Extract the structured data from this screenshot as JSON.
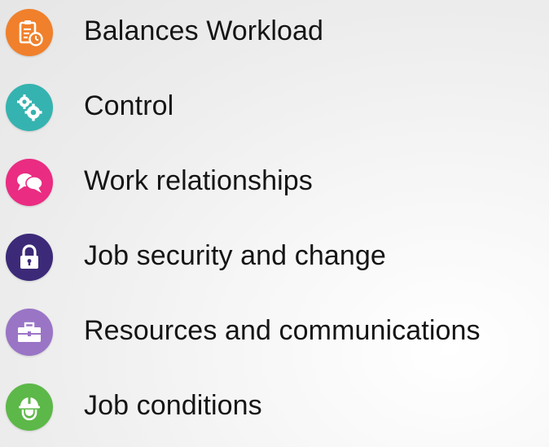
{
  "items": [
    {
      "label": "Balances Workload",
      "icon": "clipboard-clock-icon",
      "color": "#f0802b"
    },
    {
      "label": "Control",
      "icon": "gears-icon",
      "color": "#35b3b0"
    },
    {
      "label": "Work relationships",
      "icon": "speech-bubbles-icon",
      "color": "#ea2c82"
    },
    {
      "label": "Job security and change",
      "icon": "padlock-icon",
      "color": "#3c2a78"
    },
    {
      "label": "Resources and communications",
      "icon": "toolbox-icon",
      "color": "#9a75c6"
    },
    {
      "label": "Job conditions",
      "icon": "hard-hat-worker-icon",
      "color": "#5cb848"
    }
  ]
}
